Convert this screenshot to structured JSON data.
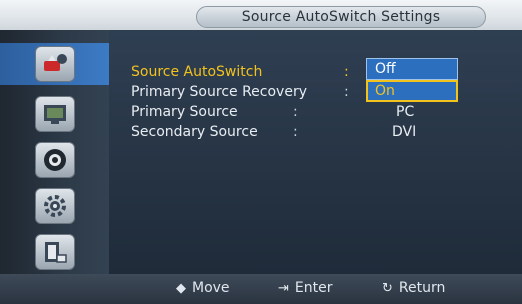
{
  "header": {
    "title": "Source AutoSwitch Settings"
  },
  "sidebar": {
    "items": [
      {
        "icon": "input-source-icon",
        "active": true
      },
      {
        "icon": "picture-icon",
        "active": false
      },
      {
        "icon": "sound-icon",
        "active": false
      },
      {
        "icon": "setup-icon",
        "active": false
      },
      {
        "icon": "multi-control-icon",
        "active": false
      }
    ]
  },
  "menu": {
    "rows": [
      {
        "label": "Source AutoSwitch",
        "colon": ":",
        "selected": true
      },
      {
        "label": "Primary Source Recovery",
        "colon": ":",
        "selected": false
      },
      {
        "label": "Primary Source",
        "colon": ":",
        "selected": false
      },
      {
        "label": "Secondary Source",
        "colon": ":",
        "selected": false
      }
    ],
    "dropdown": {
      "options": [
        "Off",
        "On"
      ],
      "highlighted": "On"
    },
    "values": {
      "primary_source": "PC",
      "secondary_source": "DVI"
    }
  },
  "footer": {
    "move": "Move",
    "enter": "Enter",
    "return": "Return"
  },
  "colors": {
    "accent": "#f2c21d",
    "highlight_blue": "#2d6fbf",
    "panel": "#1f2b39"
  }
}
